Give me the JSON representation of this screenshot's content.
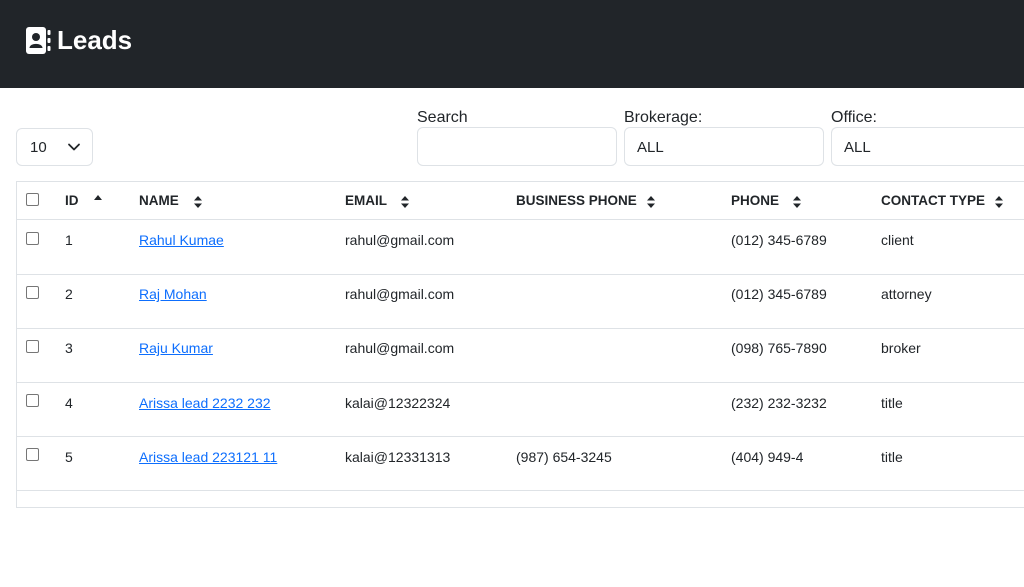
{
  "header": {
    "title": "Leads",
    "icon": "contact-book-icon"
  },
  "toolbar": {
    "page_size": "10",
    "search_label": "Search",
    "search_value": "",
    "brokerage_label": "Brokerage:",
    "brokerage_value": "ALL",
    "office_label": "Office:",
    "office_value": "ALL"
  },
  "table": {
    "columns": [
      "ID",
      "NAME",
      "EMAIL",
      "BUSINESS PHONE",
      "PHONE",
      "CONTACT TYPE"
    ],
    "rows": [
      {
        "id": "1",
        "name": "Rahul Kumae",
        "email": "rahul@gmail.com",
        "business_phone": "",
        "phone": "(012) 345-6789",
        "contact_type": "client"
      },
      {
        "id": "2",
        "name": "Raj Mohan",
        "email": "rahul@gmail.com",
        "business_phone": "",
        "phone": "(012) 345-6789",
        "contact_type": "attorney"
      },
      {
        "id": "3",
        "name": "Raju Kumar",
        "email": "rahul@gmail.com",
        "business_phone": "",
        "phone": "(098) 765-7890",
        "contact_type": "broker"
      },
      {
        "id": "4",
        "name": "Arissa lead 2232 232",
        "email": "kalai@12322324",
        "business_phone": "",
        "phone": "(232) 232-3232",
        "contact_type": "title"
      },
      {
        "id": "5",
        "name": "Arissa lead 223121 11",
        "email": "kalai@12331313",
        "business_phone": "(987) 654-3245",
        "phone": "(404) 949-4",
        "contact_type": "title"
      }
    ]
  },
  "colors": {
    "header_bg": "#212529",
    "link": "#0d6efd",
    "border": "#dee2e6"
  }
}
